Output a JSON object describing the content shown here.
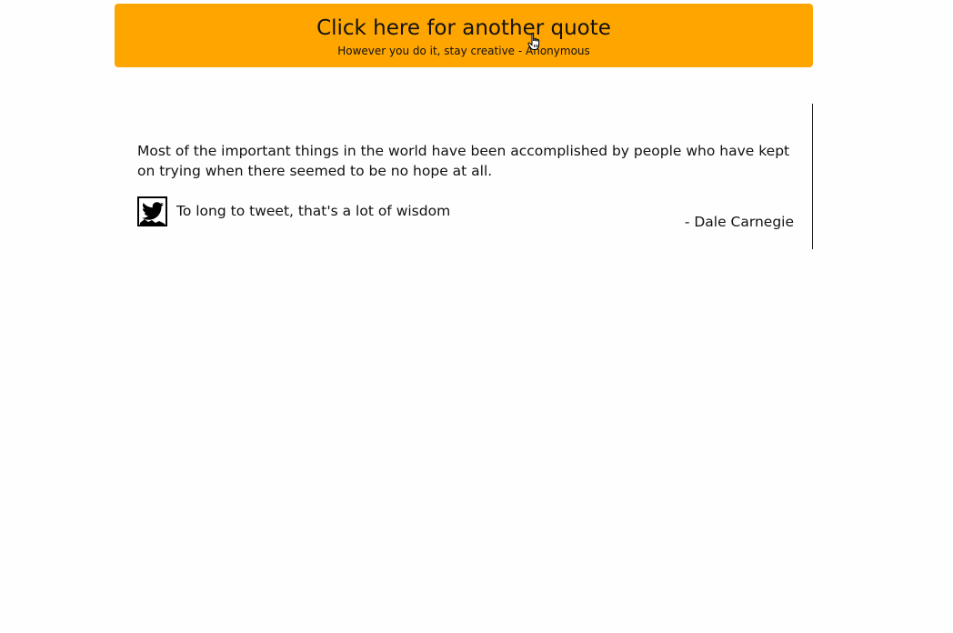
{
  "button": {
    "title": "Click here for another quote",
    "subtitle": "However you do it, stay creative - Anonymous",
    "color": "#ffa500"
  },
  "quote": {
    "text": "Most of the important things in the world have been accomplished by people who have kept on trying when there seemed to be no hope at all.",
    "author": "- Dale Carnegie"
  },
  "tweet": {
    "icon": "twitter-icon",
    "note": "To long to tweet, that's a lot of wisdom"
  },
  "cursor": {
    "icon": "hand-pointer-icon"
  }
}
